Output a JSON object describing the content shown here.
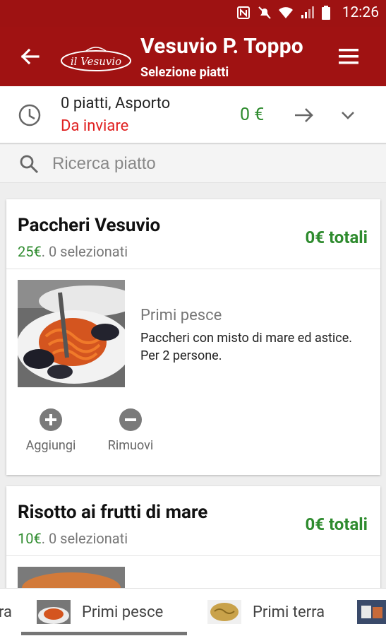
{
  "status_bar": {
    "time": "12:26"
  },
  "app_bar": {
    "title": "Vesuvio P. Toppo",
    "subtitle": "Selezione piatti",
    "logo_text": "il Vesuvio"
  },
  "order_summary": {
    "count_text": "0 piatti, Asporto",
    "state_text": "Da inviare",
    "amount": "0 €"
  },
  "search": {
    "placeholder": "Ricerca piatto"
  },
  "dishes": [
    {
      "name": "Paccheri Vesuvio",
      "price": "25€",
      "selected": ". 0 selezionati",
      "total": "0€ totali",
      "category": "Primi pesce",
      "description": "Paccheri con misto di mare ed astice. Per 2 persone.",
      "add_label": "Aggiungi",
      "remove_label": "Rimuovi"
    },
    {
      "name": "Risotto ai frutti di mare",
      "price": "10€",
      "selected": ". 0 selezionati",
      "total": "0€ totali"
    }
  ],
  "tabs": [
    {
      "label": "ra"
    },
    {
      "label": "Primi pesce"
    },
    {
      "label": "Primi terra"
    }
  ],
  "colors": {
    "primary": "#a01212",
    "price_green": "#2e8b2e",
    "pending_red": "#e02020"
  }
}
